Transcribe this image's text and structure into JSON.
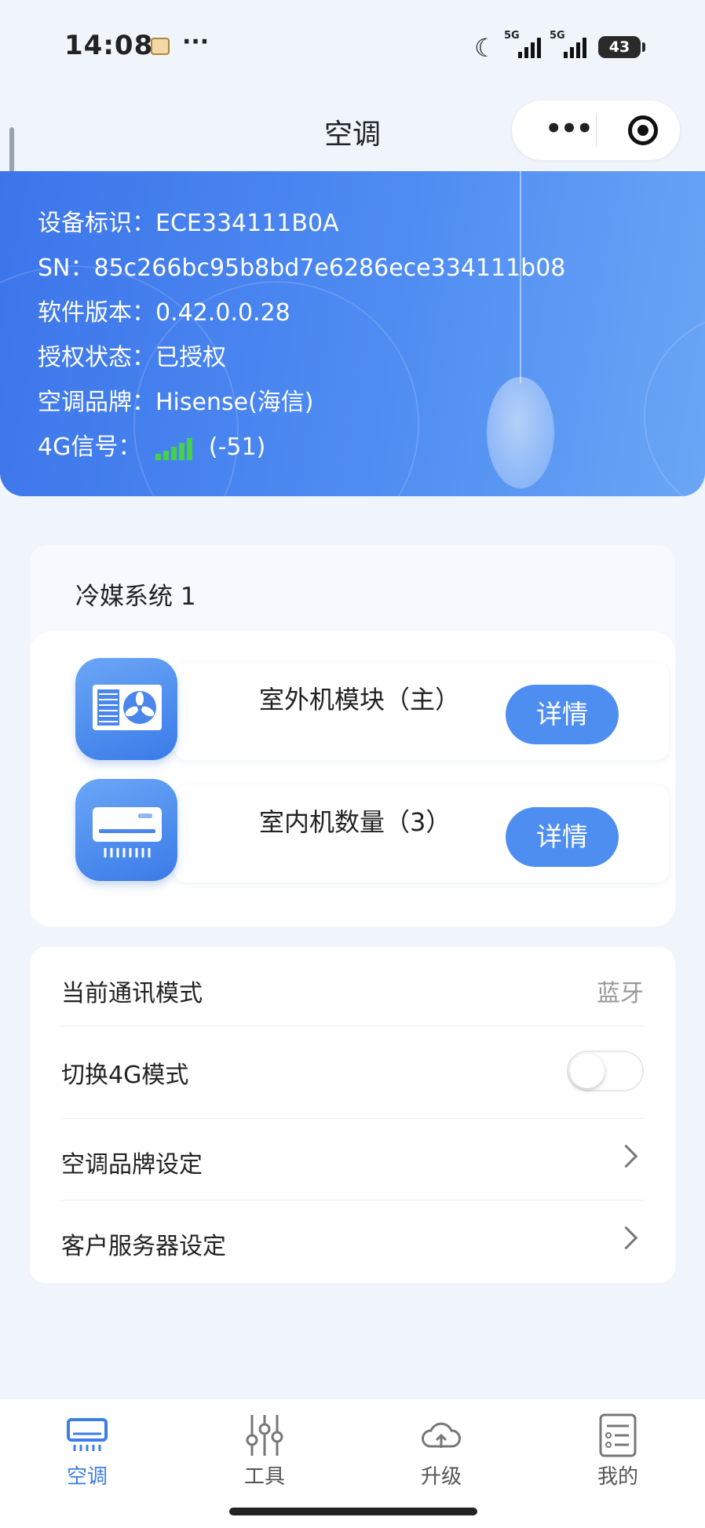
{
  "status_bar": {
    "time": "14:08",
    "dots": "···",
    "signal1": "5G",
    "signal2": "5G",
    "battery": "43"
  },
  "nav": {
    "title": "空调",
    "more": "•••"
  },
  "device_info": [
    {
      "label": "设备标识：",
      "value": "ECE334111B0A"
    },
    {
      "label": "SN：",
      "value": "85c266bc95b8bd7e6286ece334111b08"
    },
    {
      "label": "软件版本：",
      "value": "0.42.0.0.28"
    },
    {
      "label": "授权状态：",
      "value": "已授权"
    },
    {
      "label": "空调品牌：",
      "value": "Hisense(海信)"
    },
    {
      "label": "4G信号：",
      "value": "(-51)"
    }
  ],
  "refrigerant": {
    "title": "冷媒系统 1",
    "units": [
      {
        "label": "室外机模块（主）",
        "button": "详情",
        "icon": "outdoor-unit-icon"
      },
      {
        "label": "室内机数量（3）",
        "button": "详情",
        "icon": "indoor-unit-icon"
      }
    ]
  },
  "settings": {
    "comm_mode": {
      "label": "当前通讯模式",
      "value": "蓝牙"
    },
    "switch_4g": {
      "label": "切换4G模式",
      "on": false
    },
    "brand": {
      "label": "空调品牌设定"
    },
    "server": {
      "label": "客户服务器设定"
    }
  },
  "tabs": [
    {
      "label": "空调",
      "icon": "air-conditioner-icon",
      "active": true
    },
    {
      "label": "工具",
      "icon": "sliders-icon",
      "active": false
    },
    {
      "label": "升级",
      "icon": "cloud-upload-icon",
      "active": false
    },
    {
      "label": "我的",
      "icon": "profile-list-icon",
      "active": false
    }
  ],
  "colors": {
    "accent": "#4e8ef0",
    "tab_active": "#3c7de8",
    "signal_green": "#45d14a"
  }
}
